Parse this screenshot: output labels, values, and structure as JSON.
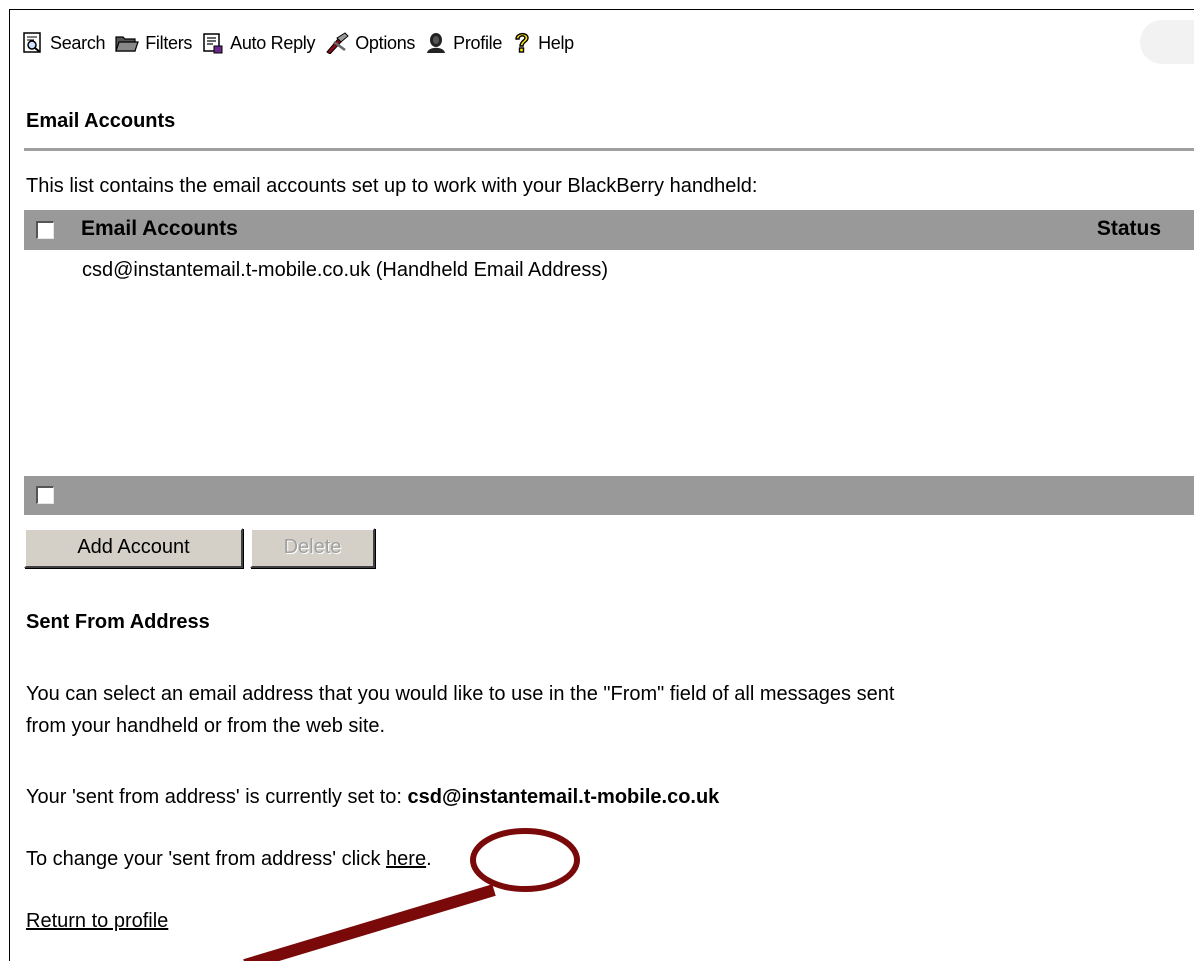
{
  "toolbar": {
    "items": [
      {
        "label": "Search",
        "icon": "search-document-icon"
      },
      {
        "label": "Filters",
        "icon": "folder-icon"
      },
      {
        "label": "Auto Reply",
        "icon": "auto-reply-icon"
      },
      {
        "label": "Options",
        "icon": "options-icon"
      },
      {
        "label": "Profile",
        "icon": "profile-icon"
      },
      {
        "label": "Help",
        "icon": "help-icon"
      }
    ]
  },
  "email_accounts": {
    "heading": "Email Accounts",
    "intro": "This list contains the email accounts set up to work with your BlackBerry handheld:",
    "table": {
      "columns": [
        "Email Accounts",
        "Status"
      ],
      "rows": [
        {
          "account": "csd@instantemail.t-mobile.co.uk  (Handheld Email Address)",
          "status": ""
        }
      ]
    },
    "buttons": {
      "add": "Add Account",
      "delete": "Delete"
    }
  },
  "sent_from": {
    "heading": "Sent From Address",
    "description_line1": "You can select an email address that you would like to use in the \"From\" field of all messages sent",
    "description_line2": "from your handheld or from the web site.",
    "current_prefix": "Your 'sent from address' is currently set to: ",
    "current_value": "csd@instantemail.t-mobile.co.uk",
    "change_prefix": "To change your 'sent from address' click ",
    "change_link": "here",
    "change_suffix": "."
  },
  "return_link": "Return to profile",
  "annotation": {
    "color": "#7a0a0a"
  }
}
